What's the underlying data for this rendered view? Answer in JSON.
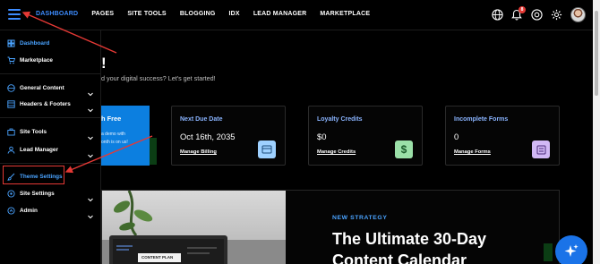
{
  "topnav": {
    "items": [
      "DASHBOARD",
      "PAGES",
      "SITE TOOLS",
      "BLOGGING",
      "IDX",
      "LEAD MANAGER",
      "MARKETPLACE"
    ],
    "active": "DASHBOARD",
    "notification_count": "8",
    "icons": [
      "globe-icon",
      "bell-icon",
      "support-icon",
      "gear-icon",
      "avatar"
    ]
  },
  "sidebar": {
    "items": [
      {
        "label": "Dashboard",
        "icon": "dashboard-icon",
        "color": "#4aa3ff"
      },
      {
        "label": "Marketplace",
        "icon": "cart-icon"
      },
      {
        "label": "General Content",
        "icon": "globe-icon"
      },
      {
        "label": "Headers & Footers",
        "icon": "layout-icon"
      },
      {
        "label": "Site Tools",
        "icon": "toolbox-icon"
      },
      {
        "label": "Lead Manager",
        "icon": "user-icon"
      },
      {
        "label": "Theme Settings",
        "icon": "brush-icon",
        "color": "#4aa3ff"
      },
      {
        "label": "Site Settings",
        "icon": "settings-icon"
      },
      {
        "label": "Admin",
        "icon": "admin-icon"
      }
    ]
  },
  "main": {
    "welcome_bang": "!",
    "welcome_sub": "d your digital success? Let's get started!",
    "promo": {
      "title": "h Free",
      "line1": "a demo with",
      "line2": "onth is on us!"
    },
    "cards": [
      {
        "title": "Next Due Date",
        "value": "Oct 16th, 2035",
        "link": "Manage Billing",
        "icon": "billing-icon",
        "icon_bg": "#9ed1ff"
      },
      {
        "title": "Loyalty Credits",
        "value": "$0",
        "link": "Manage Credits",
        "icon": "dollar-icon",
        "icon_bg": "#9be0a8"
      },
      {
        "title": "Incomplete Forms",
        "value": "0",
        "link": "Manage Forms",
        "icon": "form-icon",
        "icon_bg": "#d1b8f5"
      }
    ],
    "article": {
      "kicker": "NEW STRATEGY",
      "title_line1": "The Ultimate 30-Day",
      "title_line2": "Content Calendar",
      "photo_text": "CONTENT PLAN"
    }
  },
  "colors": {
    "accent": "#3d8cff",
    "annotation": "#e53935",
    "fab": "#1a73e8"
  }
}
